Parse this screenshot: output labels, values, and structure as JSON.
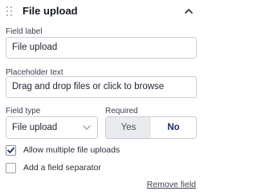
{
  "header": {
    "title": "File upload"
  },
  "fields": {
    "label": {
      "label": "Field label",
      "value": "File upload"
    },
    "placeholder": {
      "label": "Placeholder text",
      "value": "Drag and drop files or click to browse"
    },
    "type": {
      "label": "Field type",
      "selected": "File upload"
    },
    "required": {
      "label": "Required",
      "yes_label": "Yes",
      "no_label": "No",
      "selected": "No"
    }
  },
  "options": [
    {
      "label": "Allow multiple file uploads",
      "checked": true
    },
    {
      "label": "Add a field separator",
      "checked": false
    }
  ],
  "actions": {
    "remove_label": "Remove field"
  },
  "colors": {
    "accent": "#1a2e6e",
    "border": "#c9ccd3"
  }
}
